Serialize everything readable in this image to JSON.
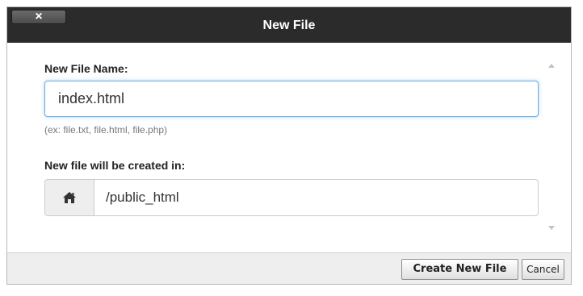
{
  "dialog": {
    "title": "New File",
    "close_icon": "close-icon",
    "close_glyph": "×"
  },
  "form": {
    "name_label": "New File Name:",
    "name_value": "index.html",
    "hint": "(ex: file.txt, file.html, file.php)",
    "location_label": "New file will be created in:",
    "location_icon": "home-icon",
    "location_path": "/public_html"
  },
  "footer": {
    "create_label": "Create New File",
    "cancel_label": "Cancel"
  },
  "colors": {
    "titlebar": "#2b2b2b",
    "input_focus": "#66afe9",
    "footer": "#eeeeee"
  }
}
